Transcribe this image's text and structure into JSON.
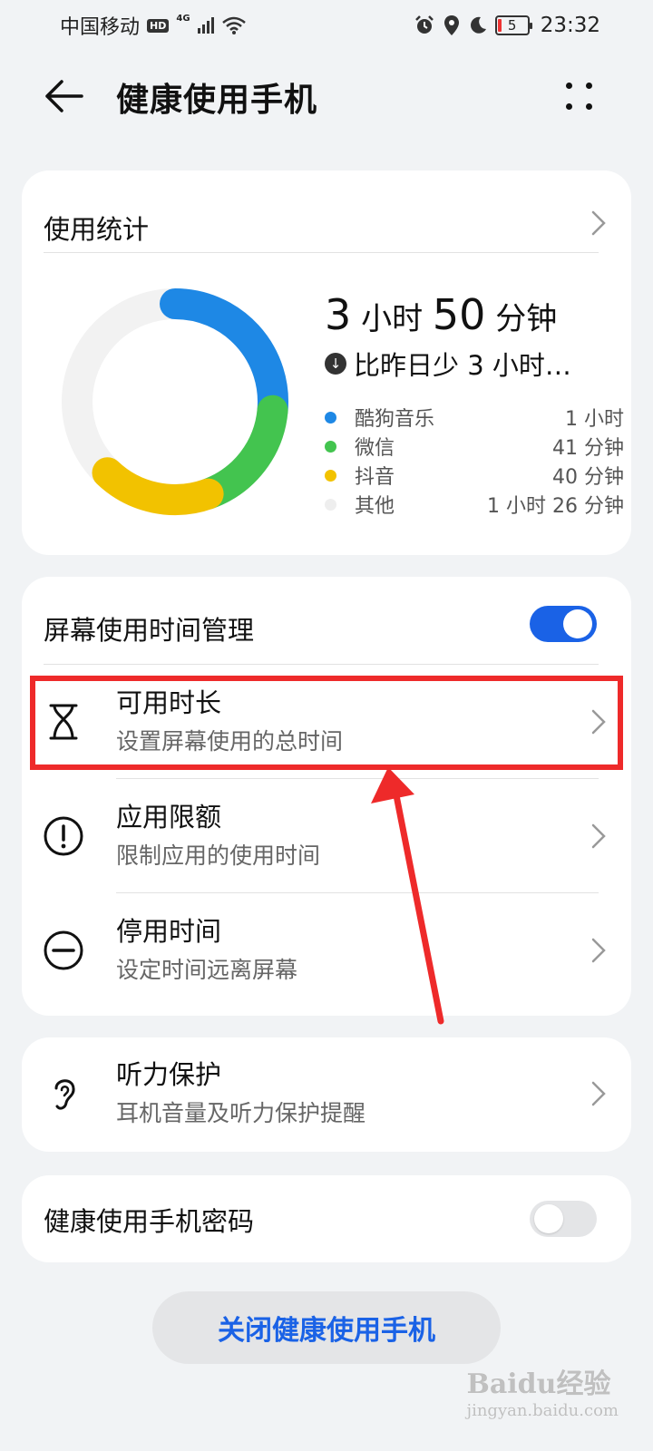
{
  "status_bar": {
    "carrier": "中国移动",
    "hd_badge": "HD",
    "network": "4G",
    "battery": "5",
    "time": "23:32",
    "icons": [
      "alarm-icon",
      "location-icon",
      "moon-icon"
    ]
  },
  "header": {
    "title": "健康使用手机"
  },
  "usage_stats": {
    "title": "使用统计",
    "total_hours": "3",
    "hours_unit": "小时",
    "total_minutes": "50",
    "minutes_unit": "分钟",
    "compare_text": "比昨日少 3 小时…",
    "apps": [
      {
        "name": "酷狗音乐",
        "value": "1 小时",
        "color": "#1e88e5",
        "minutes": 60
      },
      {
        "name": "微信",
        "value": "41 分钟",
        "color": "#43c44f",
        "minutes": 41
      },
      {
        "name": "抖音",
        "value": "40 分钟",
        "color": "#f2c200",
        "minutes": 40
      },
      {
        "name": "其他",
        "value": "1 小时 26 分钟",
        "color": "#eeeeee",
        "minutes": 86
      }
    ]
  },
  "screen_time": {
    "title": "屏幕使用时间管理",
    "enabled": true,
    "items": [
      {
        "title": "可用时长",
        "subtitle": "设置屏幕使用的总时间",
        "icon": "hourglass-icon"
      },
      {
        "title": "应用限额",
        "subtitle": "限制应用的使用时间",
        "icon": "exclamation-circle-icon"
      },
      {
        "title": "停用时间",
        "subtitle": "设定时间远离屏幕",
        "icon": "minus-circle-icon"
      }
    ]
  },
  "hearing": {
    "title": "听力保护",
    "subtitle": "耳机音量及听力保护提醒",
    "icon": "ear-icon"
  },
  "password": {
    "title": "健康使用手机密码",
    "enabled": false
  },
  "close_button": "关闭健康使用手机",
  "watermark": {
    "text": "Baidu经验",
    "sub": "jingyan.baidu.com"
  },
  "colors": {
    "accent": "#1a62e6",
    "highlight": "#ee2a2a"
  }
}
